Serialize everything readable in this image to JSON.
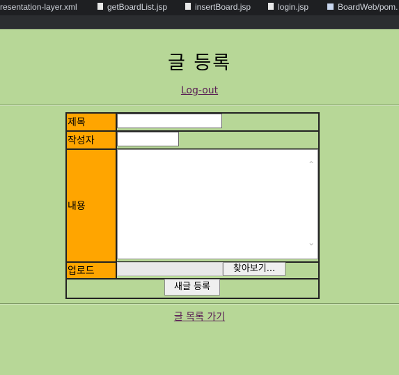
{
  "editor_tabs": [
    {
      "label": "resentation-layer.xml",
      "icon": "xml-file-icon"
    },
    {
      "label": "getBoardList.jsp",
      "icon": "jsp-file-icon"
    },
    {
      "label": "insertBoard.jsp",
      "icon": "jsp-file-icon"
    },
    {
      "label": "login.jsp",
      "icon": "jsp-file-icon"
    },
    {
      "label": "BoardWeb/pom.",
      "icon": "maven-file-icon"
    }
  ],
  "page": {
    "title": "글 등록",
    "logout_link": "Log-out",
    "form": {
      "title_label": "제목",
      "writer_label": "작성자",
      "content_label": "내용",
      "upload_label": "업로드",
      "title_value": "",
      "writer_value": "",
      "content_value": "",
      "browse_button": "찾아보기...",
      "submit_button": "새글 등록"
    },
    "list_link": "글 목록 가기"
  },
  "colors": {
    "background": "#b7d797",
    "label_cell": "#ffa500",
    "link": "#5a1f55"
  }
}
